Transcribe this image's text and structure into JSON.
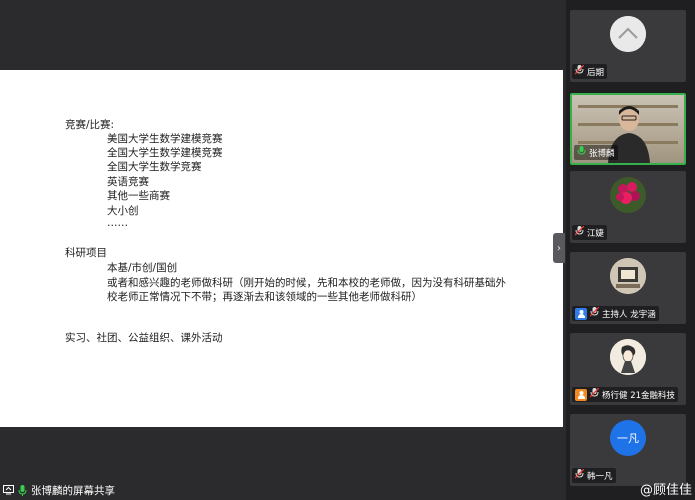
{
  "slide": {
    "heading_1": "竞赛/比赛:",
    "competitions": [
      "美国大学生数学建模竞赛",
      "全国大学生数学建模竞赛",
      "全国大学生数学竞赛",
      "英语竞赛",
      "其他一些商赛",
      "大小创",
      "……"
    ],
    "heading_2": "科研项目",
    "research": [
      "本基/市创/国创",
      "或者和感兴趣的老师做科研（刚开始的时候，先和本校的老师做，因为没有科研基础外",
      "校老师正常情况下不带；再逐渐去和该领域的一些其他老师做科研）"
    ],
    "other": "实习、社团、公益组织、课外活动"
  },
  "collapse_icon": "chevron-right-icon",
  "bottom_bar": {
    "share_label": "张博麟的屏幕共享"
  },
  "participants": [
    {
      "name": "后期",
      "avatar_color": "#e6e6e6"
    },
    {
      "name": "张博麟",
      "avatar_color": "#2b2b2b"
    },
    {
      "name": "江婕",
      "avatar_color": "#c2185b"
    },
    {
      "name": "主持人 龙宇涵",
      "avatar_color": "#d8cfc0"
    },
    {
      "name": "杨行健 21金融科技",
      "avatar_color": "#efe8dc"
    },
    {
      "name": "韩一凡",
      "avatar_color": "#1f73e8",
      "avatar_text": "一凡"
    }
  ],
  "watermark": "@顾佳佳"
}
